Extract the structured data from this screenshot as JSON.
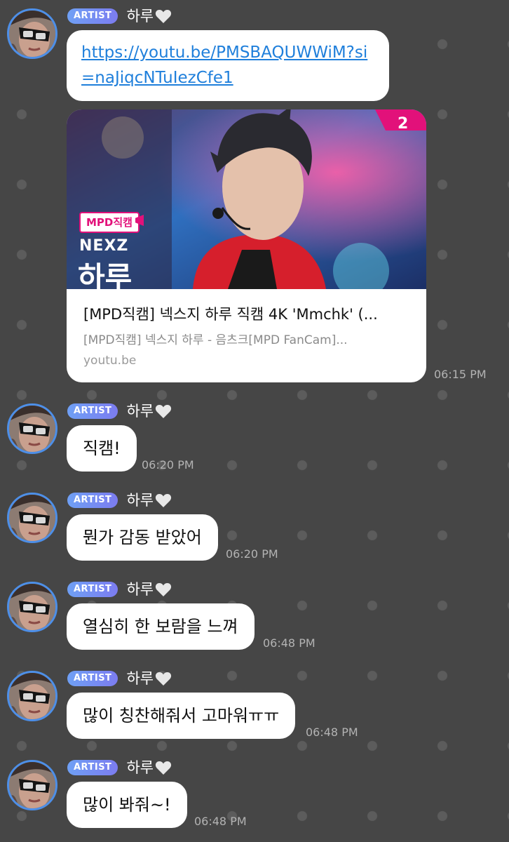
{
  "artist_badge": "ARTIST",
  "nickname": "하루",
  "messages": [
    {
      "type": "link",
      "url_text": "https://youtu.be/PMSBAQUWWiM?si=naJiqcNTuIezCfe1",
      "preview": {
        "tag": "MPD직캠",
        "group": "NEXZ",
        "member": "하루",
        "title": "[MPD직캠] 넥스지 하루 직캠 4K 'Mmchk' (...",
        "description": "[MPD직캠] 넥스지 하루 - 음츠크[MPD FanCam]...",
        "domain": "youtu.be"
      },
      "time": "06:15 PM"
    },
    {
      "type": "text",
      "text": "직캠!",
      "time": "06:20 PM"
    },
    {
      "type": "text",
      "text": "뭔가 감동 받았어",
      "time": "06:20 PM"
    },
    {
      "type": "text",
      "text": "열심히 한 보람을 느껴",
      "time": "06:48 PM"
    },
    {
      "type": "text",
      "text": "많이 칭찬해줘서 고마워ㅠㅠ",
      "time": "06:48 PM"
    },
    {
      "type": "text",
      "text": "많이 봐줘~!",
      "time": "06:48 PM"
    }
  ],
  "colors": {
    "background": "#464646",
    "badge": "#6fa0f5",
    "link": "#1f7fdb",
    "avatar_ring": "#4d8fe8"
  }
}
